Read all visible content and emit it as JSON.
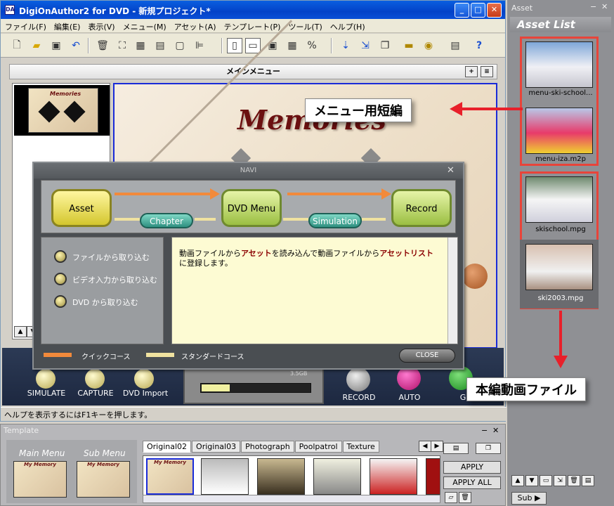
{
  "window": {
    "title": "DigiOnAuthor2 for DVD - 新規プロジェクト*"
  },
  "menu": [
    "ファイル(F)",
    "編集(E)",
    "表示(V)",
    "メニュー(M)",
    "アセット(A)",
    "テンプレート(P)",
    "ツール(T)",
    "ヘルプ(H)"
  ],
  "editor": {
    "header": "メインメニュー",
    "thumb_title": "Memories",
    "canvas_title": "Memories"
  },
  "bottom": {
    "simulate": "SIMULATE",
    "capture": "CAPTURE",
    "dvd_import": "DVD Import",
    "record": "RECORD",
    "auto": "AUTO",
    "cut": "G",
    "gauge_label": "3.5GB"
  },
  "status": "ヘルプを表示するにはF1キーを押します。",
  "navi": {
    "title": "NAVI",
    "steps": {
      "asset": "Asset",
      "chapter": "Chapter",
      "dvd_menu": "DVD Menu",
      "simulation": "Simulation",
      "record": "Record"
    },
    "options": [
      "ファイルから取り込む",
      "ビデオ入力から取り込む",
      "DVD から取り込む"
    ],
    "info_pre": "動画ファイルから",
    "info_h1": "アセット",
    "info_mid": "を読み込んで動画ファイルから",
    "info_h2": "アセットリスト",
    "info_post": "に登録します。",
    "quick": "クイックコース",
    "standard": "スタンダードコース",
    "close": "CLOSE"
  },
  "asset": {
    "panel_title": "Asset",
    "list_title": "Asset List",
    "items": [
      "menu-ski-school...",
      "menu-iza.m2p",
      "skischool.mpg",
      "ski2003.mpg"
    ],
    "sub": "Sub ▶"
  },
  "annotations": {
    "menu_short": "メニュー用短編",
    "main_video": "本編動画ファイル"
  },
  "template": {
    "title": "Template",
    "main_menu": "Main Menu",
    "sub_menu": "Sub Menu",
    "card_text": "My Memory",
    "tabs": [
      "Original02",
      "Original03",
      "Photograph",
      "Poolpatrol",
      "Texture"
    ],
    "apply": "APPLY",
    "apply_all": "APPLY ALL"
  },
  "colors": {
    "accent_red": "#e8443a",
    "navi_green": "#c8e070",
    "navi_teal": "#4cb6a4",
    "title_blue": "#0342c8"
  }
}
